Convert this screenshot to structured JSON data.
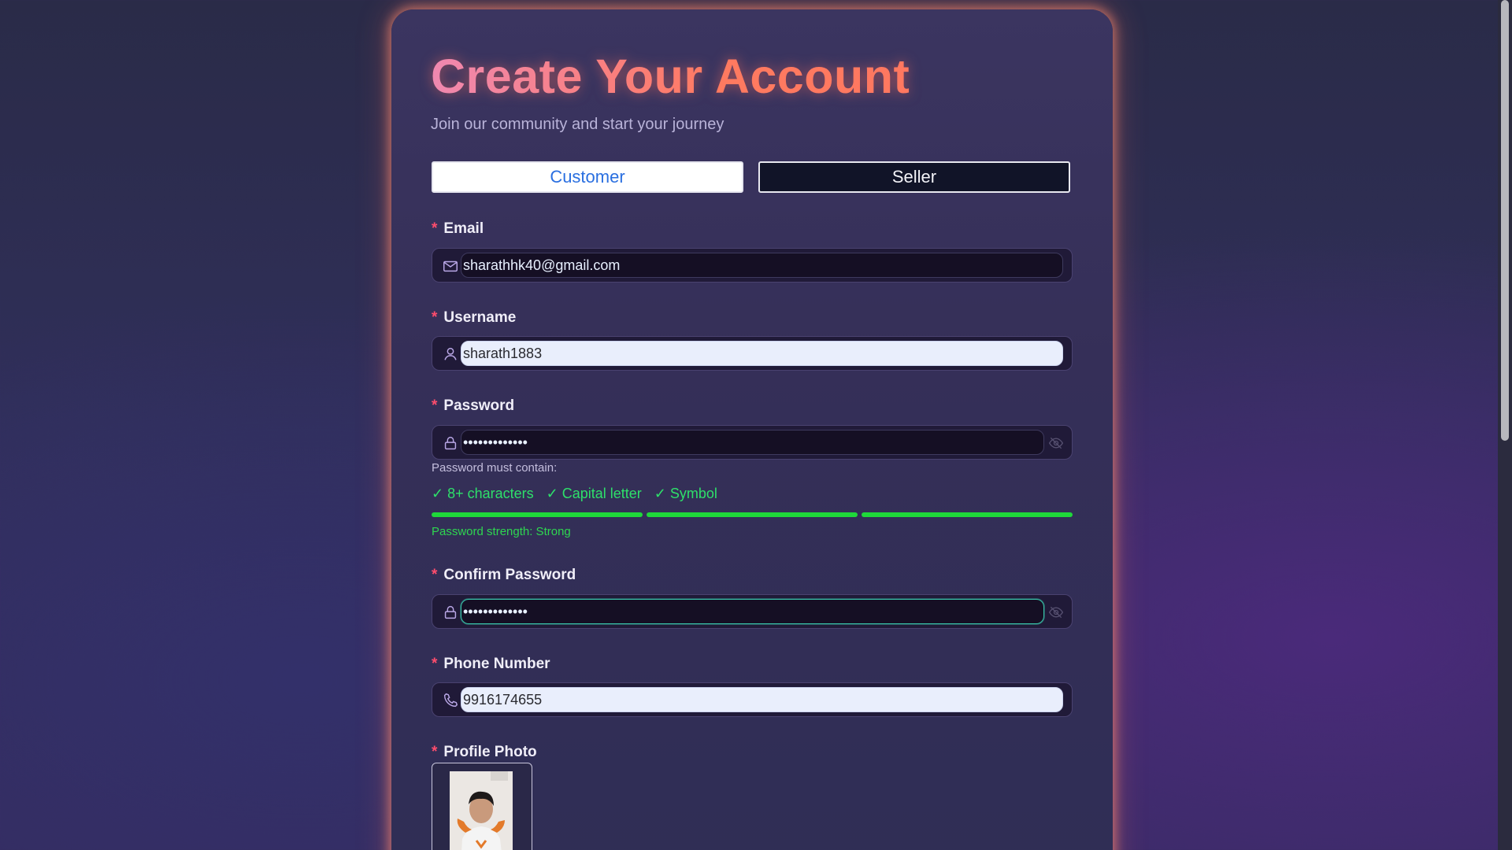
{
  "header": {
    "title": "Create Your Account",
    "subtitle": "Join our community and start your journey"
  },
  "account_type": {
    "options": [
      "Customer",
      "Seller"
    ],
    "selected": "Customer"
  },
  "fields": {
    "email": {
      "label": "Email",
      "required_mark": "*",
      "value": "sharathhk40@gmail.com",
      "icon": "mail-icon"
    },
    "username": {
      "label": "Username",
      "required_mark": "*",
      "value": "sharath1883",
      "icon": "user-icon"
    },
    "password": {
      "label": "Password",
      "required_mark": "*",
      "value": "•••••••••••••",
      "icon": "lock-icon"
    },
    "confirm_password": {
      "label": "Confirm Password",
      "required_mark": "*",
      "value": "•••••••••••••",
      "icon": "lock-icon"
    },
    "phone": {
      "label": "Phone Number",
      "required_mark": "*",
      "value": "9916174655",
      "icon": "phone-icon"
    },
    "profile_photo": {
      "label": "Profile Photo",
      "required_mark": "*"
    }
  },
  "password_rules": {
    "hint": "Password must contain:",
    "rules": [
      "✓ 8+ characters",
      "✓ Capital letter",
      "✓ Symbol"
    ],
    "strength_text": "Password strength: Strong",
    "strength_level": 1.0
  },
  "colors": {
    "accent_title": "#ff7a60",
    "required": "#ff4d6d",
    "valid": "#2ee06a",
    "strength_bar": "#1fd83a",
    "customer_text": "#2a6fe0"
  }
}
